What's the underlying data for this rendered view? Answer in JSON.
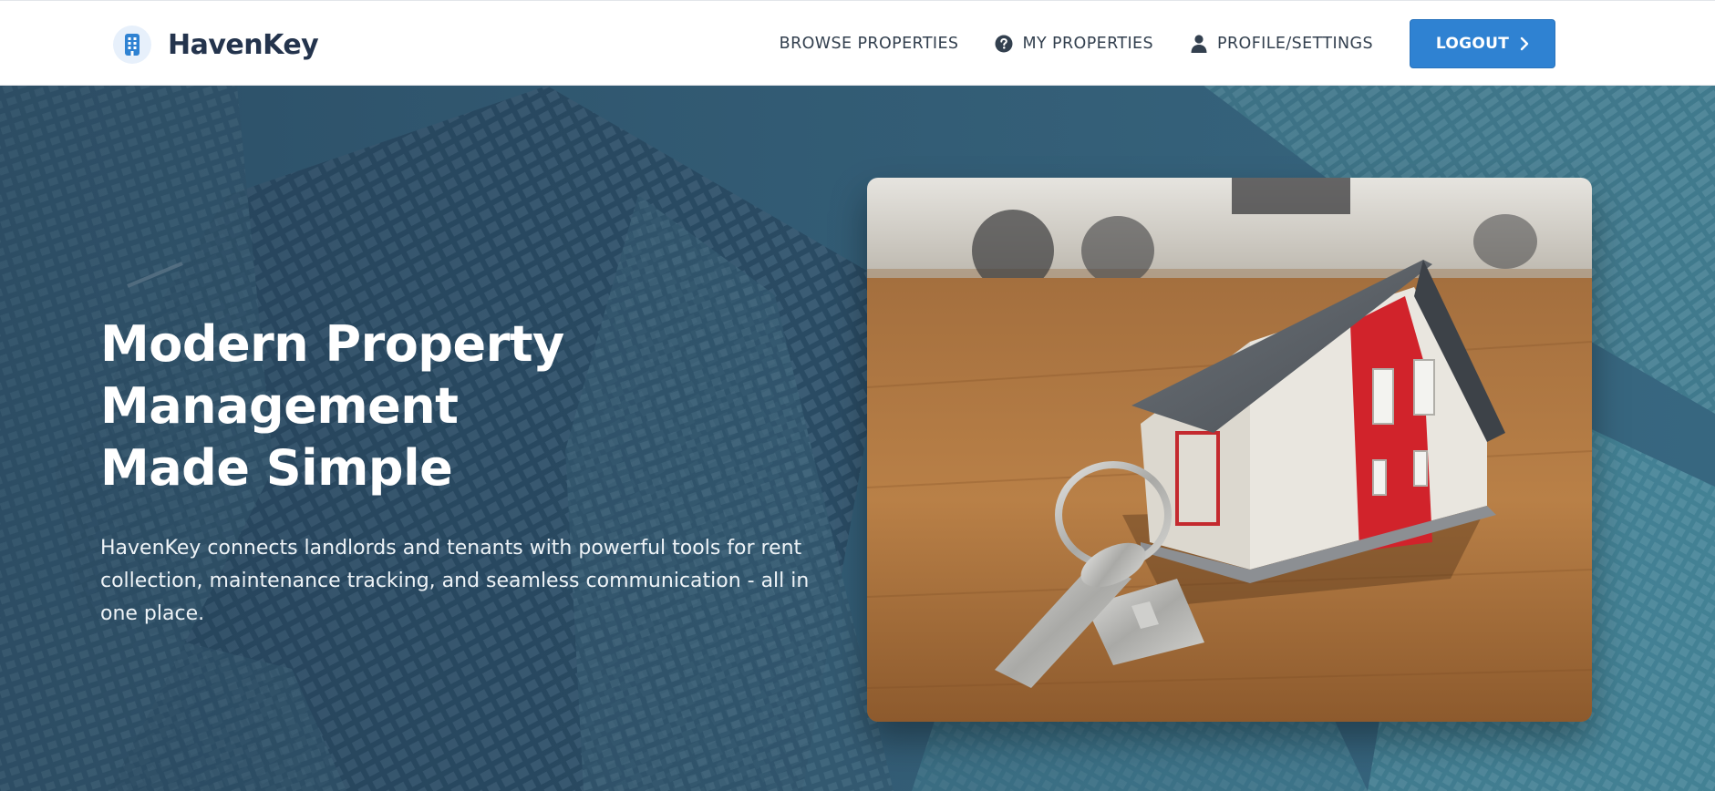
{
  "brand": {
    "name": "HavenKey",
    "icon": "building-icon",
    "accent_color": "#2f82d2",
    "text_color": "#24344d"
  },
  "nav": {
    "items": [
      {
        "label": "BROWSE PROPERTIES",
        "icon": ""
      },
      {
        "label": "MY PROPERTIES",
        "icon": "question-circle-icon"
      },
      {
        "label": "PROFILE/SETTINGS",
        "icon": "user-icon"
      }
    ],
    "logout_label": "LOGOUT",
    "logout_icon": "chevron-right-icon"
  },
  "hero": {
    "title_line1": "Modern Property Management",
    "title_line2": "Made Simple",
    "description": "HavenKey connects landlords and tenants with powerful tools for rent collection, maintenance tracking, and seamless communication - all in one place.",
    "background": "skyscrapers-photo",
    "image": "house-with-keys-photo"
  }
}
